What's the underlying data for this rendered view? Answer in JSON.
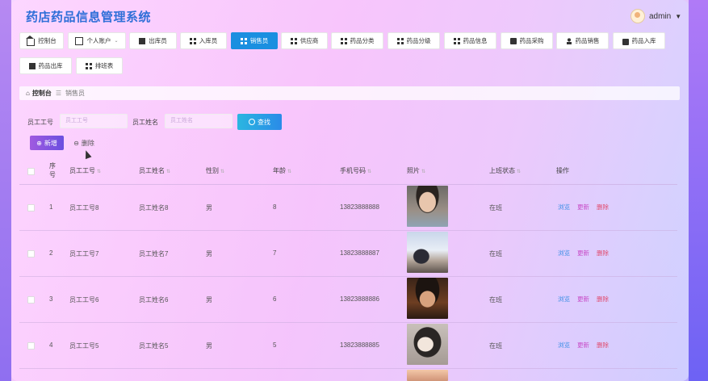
{
  "app": {
    "title": "药店药品信息管理系统"
  },
  "user": {
    "name": "admin"
  },
  "nav": [
    {
      "label": "控制台",
      "icon": "home-icon"
    },
    {
      "label": "个人账户",
      "icon": "card-icon",
      "dropdown": true
    },
    {
      "label": "出库员",
      "icon": "monitor-icon"
    },
    {
      "label": "入库员",
      "icon": "grid-icon"
    },
    {
      "label": "销售员",
      "icon": "grid-icon",
      "active": true
    },
    {
      "label": "供应商",
      "icon": "grid-icon"
    },
    {
      "label": "药品分类",
      "icon": "grid-icon"
    },
    {
      "label": "药品分级",
      "icon": "grid-icon"
    },
    {
      "label": "药品信息",
      "icon": "grid-icon"
    },
    {
      "label": "药品采购",
      "icon": "check-icon"
    },
    {
      "label": "药品销售",
      "icon": "user-icon"
    },
    {
      "label": "药品入库",
      "icon": "bag-icon"
    },
    {
      "label": "药品出库",
      "icon": "truck-icon"
    },
    {
      "label": "排班表",
      "icon": "grid-icon"
    }
  ],
  "breadcrumb": {
    "home": "控制台",
    "current": "销售员"
  },
  "filters": {
    "emp_id_label": "员工工号",
    "emp_id_placeholder": "员工工号",
    "emp_name_label": "员工姓名",
    "emp_name_placeholder": "员工姓名",
    "search_label": "查找"
  },
  "actions": {
    "add": "新增",
    "delete": "删除"
  },
  "table": {
    "headers": [
      "序号",
      "员工工号",
      "员工姓名",
      "性别",
      "年龄",
      "手机号码",
      "照片",
      "上班状态",
      "操作"
    ],
    "rows": [
      {
        "no": "1",
        "emp_id": "员工工号8",
        "name": "员工姓名8",
        "gender": "男",
        "age": "8",
        "phone": "13823888888",
        "status": "在班"
      },
      {
        "no": "2",
        "emp_id": "员工工号7",
        "name": "员工姓名7",
        "gender": "男",
        "age": "7",
        "phone": "13823888887",
        "status": "在班"
      },
      {
        "no": "3",
        "emp_id": "员工工号6",
        "name": "员工姓名6",
        "gender": "男",
        "age": "6",
        "phone": "13823888886",
        "status": "在班"
      },
      {
        "no": "4",
        "emp_id": "员工工号5",
        "name": "员工姓名5",
        "gender": "男",
        "age": "5",
        "phone": "13823888885",
        "status": "在班"
      }
    ],
    "row_actions": {
      "view": "浏览",
      "update": "更新",
      "delete": "删除"
    }
  },
  "colors": {
    "accent": "#1a8fe0",
    "title": "#2f6fd8",
    "add": "#8a55e0"
  }
}
